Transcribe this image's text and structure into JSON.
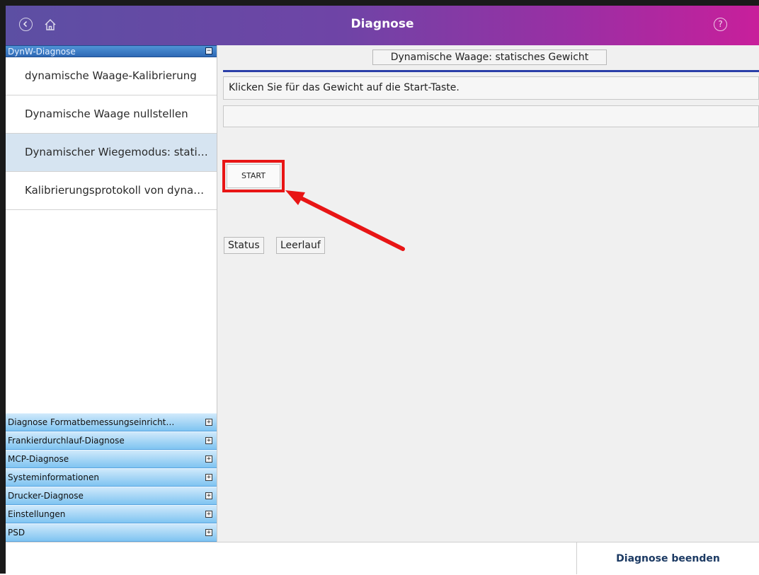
{
  "titlebar": {
    "title": "Diagnose",
    "back_icon": "back-circle-icon",
    "home_icon": "home-icon",
    "help_icon": "help-circle-icon",
    "help_glyph": "?"
  },
  "sidebar": {
    "open_section": {
      "label": "DynW-Diagnose",
      "toggle": "−",
      "items": [
        {
          "label": "dynamische Waage-Kalibrierung",
          "active": false
        },
        {
          "label": "Dynamische Waage nullstellen",
          "active": false
        },
        {
          "label": "Dynamischer Wiegemodus: statis…",
          "active": true
        },
        {
          "label": "Kalibrierungsprotokoll von dynami…",
          "active": false
        }
      ]
    },
    "sections": [
      {
        "label": "Diagnose Formatbemessungseinricht…",
        "toggle": "+"
      },
      {
        "label": "Frankierdurchlauf-Diagnose",
        "toggle": "+"
      },
      {
        "label": "MCP-Diagnose",
        "toggle": "+"
      },
      {
        "label": "Systeminformationen",
        "toggle": "+"
      },
      {
        "label": "Drucker-Diagnose",
        "toggle": "+"
      },
      {
        "label": "Einstellungen",
        "toggle": "+"
      },
      {
        "label": "PSD",
        "toggle": "+"
      }
    ]
  },
  "main": {
    "panel_title": "Dynamische Waage: statisches Gewicht",
    "instruction": "Klicken Sie für das Gewicht auf die Start-Taste.",
    "weight_value": "",
    "start_button": "START",
    "status_label": "Status",
    "status_value": "Leerlauf"
  },
  "footer": {
    "end_button": "Diagnose beenden"
  },
  "colors": {
    "title_gradient_start": "#5c4fa3",
    "title_gradient_end": "#c81f9b",
    "highlight": "#e81515",
    "accent_line": "#2b3fa8"
  }
}
